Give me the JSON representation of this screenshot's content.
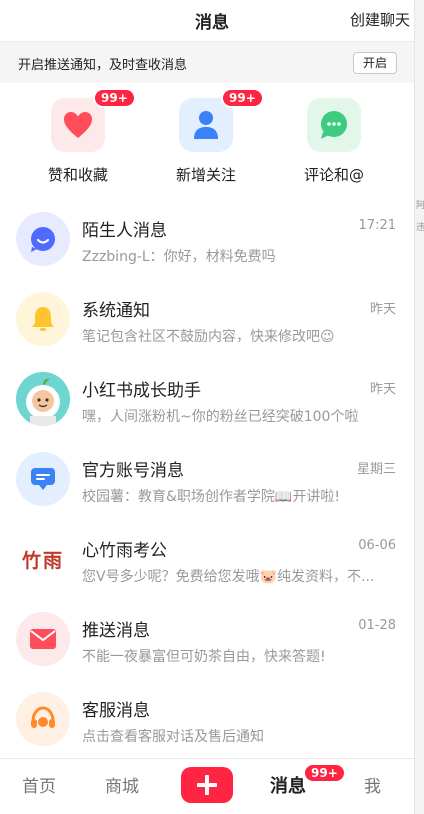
{
  "header": {
    "title": "消息",
    "create_chat": "创建聊天"
  },
  "notify": {
    "text": "开启推送通知，及时查收消息",
    "button": "开启"
  },
  "quick": [
    {
      "label": "赞和收藏",
      "badge": "99+",
      "icon": "heart-icon",
      "bg": "#fde8ea",
      "color": "#ff4d5a"
    },
    {
      "label": "新增关注",
      "badge": "99+",
      "icon": "person-icon",
      "bg": "#e3efff",
      "color": "#3b82f6"
    },
    {
      "label": "评论和@",
      "badge": "",
      "icon": "chat-bubble-icon",
      "bg": "#e3f6ea",
      "color": "#3ccb7f"
    }
  ],
  "messages": [
    {
      "title": "陌生人消息",
      "subtitle": "Zzzbing-L：你好，材料免费吗",
      "time": "17:21",
      "icon": "stranger-chat-icon"
    },
    {
      "title": "系统通知",
      "subtitle": "笔记包含社区不鼓励内容，快来修改吧😉",
      "time": "昨天",
      "icon": "bell-icon"
    },
    {
      "title": "小红书成长助手",
      "subtitle": "嘿，人间涨粉机~你的粉丝已经突破100个啦",
      "time": "昨天",
      "icon": "astronaut-avatar"
    },
    {
      "title": "官方账号消息",
      "subtitle": "校园薯：教育&职场创作者学院📖开讲啦!",
      "time": "星期三",
      "icon": "message-box-icon"
    },
    {
      "title": "心竹雨考公",
      "subtitle": "您V号多少呢？免费给您发哦🐷纯发资料，不...",
      "time": "06-06",
      "icon": "zhuyu-logo",
      "logo_text": "竹雨"
    },
    {
      "title": "推送消息",
      "subtitle": "不能一夜暴富但可奶茶自由，快来答题!",
      "time": "01-28",
      "icon": "envelope-icon"
    },
    {
      "title": "客服消息",
      "subtitle": "点击查看客服对话及售后通知",
      "time": "",
      "icon": "headset-icon"
    }
  ],
  "tabbar": {
    "home": "首页",
    "mall": "商城",
    "messages": "消息",
    "messages_badge": "99+",
    "me": "我"
  },
  "colors": {
    "accent": "#ff2442"
  },
  "rightstrip": {
    "chars": [
      "阿",
      "违"
    ]
  }
}
